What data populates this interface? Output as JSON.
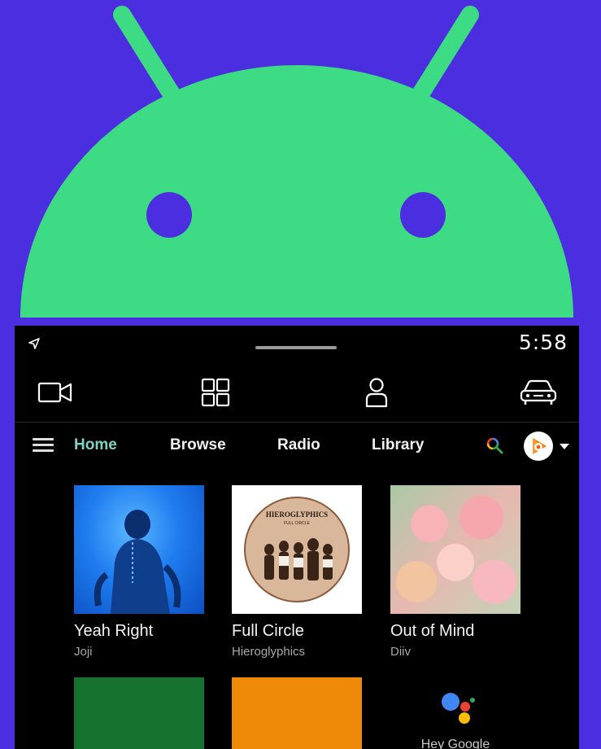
{
  "colors": {
    "background": "#4a2ee0",
    "android_green": "#3ddc84",
    "accent_tab": "#7fd3c4",
    "tile_green": "#16722f",
    "tile_orange": "#ee8a08"
  },
  "status_bar": {
    "time": "5:58",
    "navigation_icon": "location-arrow-icon"
  },
  "system_nav": {
    "icons": [
      "video-camera-icon",
      "apps-grid-icon",
      "person-icon",
      "car-icon"
    ]
  },
  "app_bar": {
    "tabs": [
      {
        "label": "Home",
        "active": true
      },
      {
        "label": "Browse",
        "active": false
      },
      {
        "label": "Radio",
        "active": false
      },
      {
        "label": "Library",
        "active": false
      }
    ],
    "search_icon": "search-icon",
    "account_icon": "play-music-icon"
  },
  "albums": [
    {
      "title": "Yeah Right",
      "artist": "Joji"
    },
    {
      "title": "Full Circle",
      "artist": "Hieroglyphics",
      "art_text": "HIEROGLYPHICS",
      "art_subtext": "FULL CIRCLE"
    },
    {
      "title": "Out of Mind",
      "artist": "Diiv"
    }
  ],
  "assistant": {
    "label": "Hey Google",
    "icon": "google-assistant-icon"
  }
}
